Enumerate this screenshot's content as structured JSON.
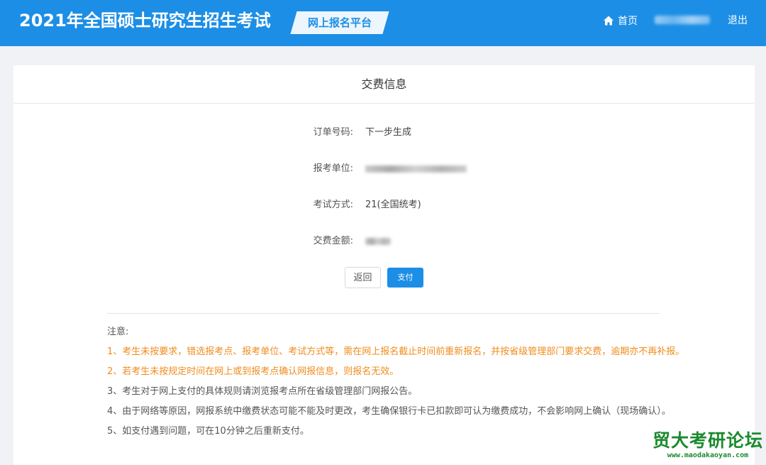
{
  "header": {
    "title": "2021年全国硕士研究生招生考试",
    "platform": "网上报名平台",
    "home": "首页",
    "logout": "退出"
  },
  "panel": {
    "title": "交费信息",
    "fields": [
      {
        "label": "订单号码:",
        "value": "下一步生成"
      },
      {
        "label": "报考单位:",
        "value": ""
      },
      {
        "label": "考试方式:",
        "value": "21(全国统考)"
      },
      {
        "label": "交费金额:",
        "value": ""
      }
    ],
    "back_label": "返回",
    "pay_label": "支付"
  },
  "notes": {
    "title": "注意:",
    "items": [
      "1、考生未按要求，错选报考点、报考单位、考试方式等，需在网上报名截止时间前重新报名，并按省级管理部门要求交费，逾期亦不再补报。",
      "2、若考生未按规定时间在网上或到报考点确认网报信息，则报名无效。",
      "3、考生对于网上支付的具体规则请浏览报考点所在省级管理部门网报公告。",
      "4、由于网络等原因，网报系统中缴费状态可能不能及时更改，考生确保银行卡已扣款即可认为缴费成功，不会影响网上确认（现场确认）。",
      "5、如支付遇到问题，可在10分钟之后重新支付。"
    ]
  },
  "watermark": {
    "title": "贸大考研论坛",
    "url": "www.maodakaoyan.com"
  },
  "colors": {
    "header_bg": "#1c8ee6",
    "warning": "#f08c1c",
    "watermark": "#1a8a2e"
  }
}
